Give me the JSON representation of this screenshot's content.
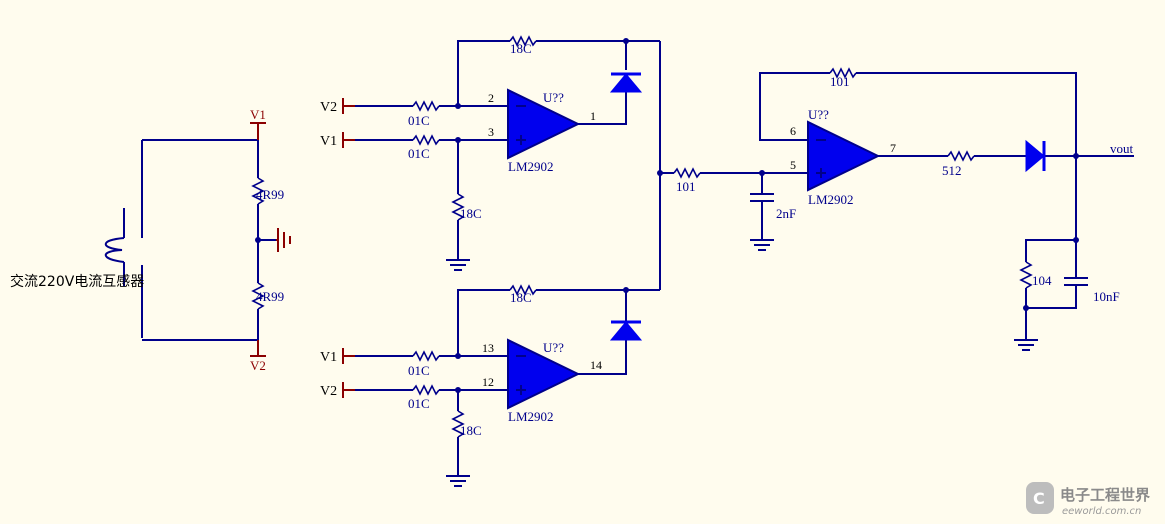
{
  "diagram": {
    "transformer_label": "交流220V电流互感器",
    "rail_top": "V1",
    "rail_bottom": "V2",
    "r_divider_top": "4R99",
    "r_divider_bottom": "4R99",
    "stage1": {
      "ports": [
        "V2",
        "V1"
      ],
      "input_resistors": [
        "01C",
        "01C"
      ],
      "feedback_resistor": "18C",
      "ground_resistor": "18C",
      "pins": [
        "2",
        "3",
        "1"
      ],
      "opamp_ref": "U??",
      "opamp_part": "LM2902"
    },
    "stage2": {
      "ports": [
        "V1",
        "V2"
      ],
      "input_resistors": [
        "01C",
        "01C"
      ],
      "feedback_resistor": "18C",
      "ground_resistor": "18C",
      "pins": [
        "13",
        "12",
        "14"
      ],
      "opamp_ref": "U??",
      "opamp_part": "LM2902"
    },
    "stage3": {
      "series_resistor": "101",
      "cap": "2nF",
      "feedback_resistor": "101",
      "pins": [
        "6",
        "5",
        "7"
      ],
      "opamp_ref": "U??",
      "opamp_part": "LM2902",
      "output_resistor": "512",
      "load_resistor": "104",
      "load_cap": "10nF",
      "output_label": "vout"
    }
  },
  "watermark": {
    "logo_letter": "C",
    "title": "电子工程世界",
    "url": "eeworld.com.cn"
  }
}
